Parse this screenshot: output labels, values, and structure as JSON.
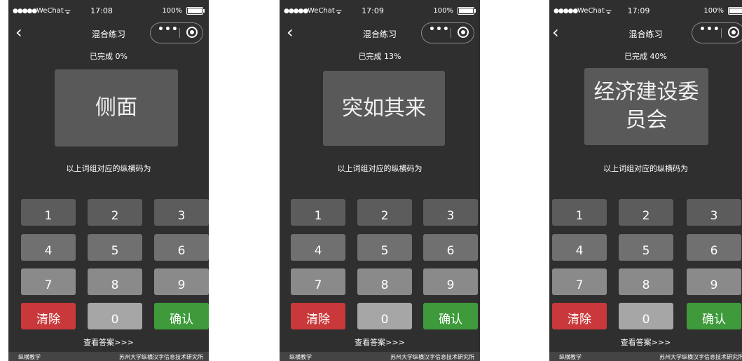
{
  "screens": [
    {
      "status": {
        "signal": "●●●●●",
        "carrier": "WeChat",
        "time": "17:08",
        "battery": "100%"
      },
      "nav_title": "混合练习",
      "capsule": {
        "more": "•••"
      },
      "progress": "已完成 0%",
      "word": "侧面",
      "prompt": "以上词组对应的纵横码为",
      "keys": [
        "1",
        "2",
        "3",
        "4",
        "5",
        "6",
        "7",
        "8",
        "9",
        "清除",
        "0",
        "确认"
      ],
      "answer_link": "查看答案>>>",
      "footer": {
        "left": "纵横教学",
        "right": "苏州大学纵横汉字信息技术研究所"
      }
    },
    {
      "status": {
        "signal": "●●●●●",
        "carrier": "WeChat",
        "time": "17:09",
        "battery": "100%"
      },
      "nav_title": "混合练习",
      "capsule": {
        "more": "•••"
      },
      "progress": "已完成 13%",
      "word": "突如其来",
      "prompt": "以上词组对应的纵横码为",
      "keys": [
        "1",
        "2",
        "3",
        "4",
        "5",
        "6",
        "7",
        "8",
        "9",
        "清除",
        "0",
        "确认"
      ],
      "answer_link": "查看答案>>>",
      "footer": {
        "left": "纵横教学",
        "right": "苏州大学纵横汉字信息技术研究所"
      }
    },
    {
      "status": {
        "signal": "●●●●●",
        "carrier": "WeChat",
        "time": "17:09",
        "battery": "100%"
      },
      "nav_title": "混合练习",
      "capsule": {
        "more": "•••"
      },
      "progress": "已完成 40%",
      "word": "经济建设委员会",
      "prompt": "以上词组对应的纵横码为",
      "keys": [
        "1",
        "2",
        "3",
        "4",
        "5",
        "6",
        "7",
        "8",
        "9",
        "清除",
        "0",
        "确认"
      ],
      "answer_link": "查看答案>>>",
      "footer": {
        "left": "纵横教学",
        "right": "苏州大学纵横汉字信息技术研究所"
      }
    }
  ],
  "colors": {
    "background": "#2f2f2f",
    "word_box": "#595959",
    "clear_key": "#c9393b",
    "confirm_key": "#3e9a3a",
    "zero_key": "#a6a6a6"
  },
  "icons": {
    "back": "chevron-left-icon",
    "record": "record-icon",
    "wifi": "wifi-icon",
    "battery": "battery-icon"
  }
}
